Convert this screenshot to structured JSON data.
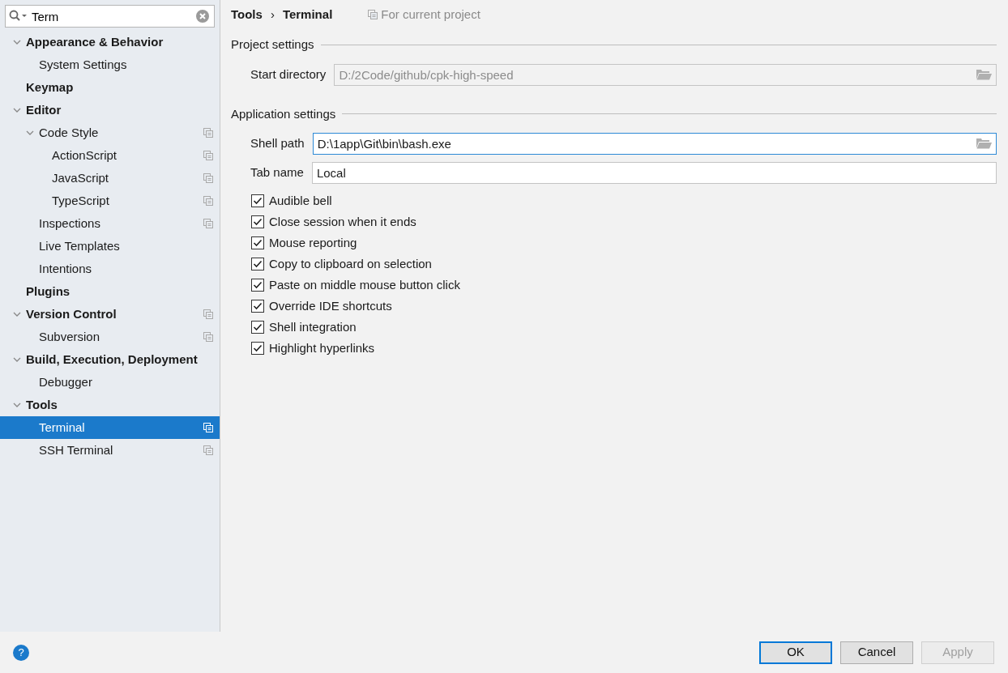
{
  "search": {
    "value": "Term"
  },
  "tree": [
    {
      "label": "Appearance & Behavior",
      "expanded": true,
      "project_scope": false,
      "selected": false,
      "children": [
        {
          "label": "System Settings",
          "project_scope": false,
          "selected": false
        }
      ]
    },
    {
      "label": "Keymap",
      "project_scope": false,
      "selected": false
    },
    {
      "label": "Editor",
      "expanded": true,
      "project_scope": false,
      "selected": false,
      "children": [
        {
          "label": "Code Style",
          "expanded": true,
          "project_scope": true,
          "selected": false,
          "children": [
            {
              "label": "ActionScript",
              "project_scope": true,
              "selected": false
            },
            {
              "label": "JavaScript",
              "project_scope": true,
              "selected": false
            },
            {
              "label": "TypeScript",
              "project_scope": true,
              "selected": false
            }
          ]
        },
        {
          "label": "Inspections",
          "project_scope": true,
          "selected": false
        },
        {
          "label": "Live Templates",
          "project_scope": false,
          "selected": false
        },
        {
          "label": "Intentions",
          "project_scope": false,
          "selected": false
        }
      ]
    },
    {
      "label": "Plugins",
      "project_scope": false,
      "selected": false
    },
    {
      "label": "Version Control",
      "expanded": true,
      "project_scope": true,
      "selected": false,
      "children": [
        {
          "label": "Subversion",
          "project_scope": true,
          "selected": false
        }
      ]
    },
    {
      "label": "Build, Execution, Deployment",
      "expanded": true,
      "project_scope": false,
      "selected": false,
      "children": [
        {
          "label": "Debugger",
          "project_scope": false,
          "selected": false
        }
      ]
    },
    {
      "label": "Tools",
      "expanded": true,
      "project_scope": false,
      "selected": false,
      "children": [
        {
          "label": "Terminal",
          "project_scope": true,
          "selected": true
        },
        {
          "label": "SSH Terminal",
          "project_scope": true,
          "selected": false
        }
      ]
    }
  ],
  "breadcrumb": [
    "Tools",
    "Terminal"
  ],
  "breadcrumb_separator": "›",
  "scope_note": "For current project",
  "sections": [
    {
      "title": "Project settings",
      "fields": [
        {
          "label": "Start directory",
          "value": "D:/2Code/github/cpk-high-speed",
          "disabled": true,
          "focused": false,
          "browse": true
        }
      ]
    },
    {
      "title": "Application settings",
      "fields": [
        {
          "label": "Shell path",
          "value": "D:\\1app\\Git\\bin\\bash.exe",
          "disabled": false,
          "focused": true,
          "browse": true
        },
        {
          "label": "Tab name",
          "value": "Local",
          "disabled": false,
          "focused": false,
          "browse": false
        }
      ]
    }
  ],
  "options": [
    {
      "label": "Audible bell",
      "checked": true
    },
    {
      "label": "Close session when it ends",
      "checked": true
    },
    {
      "label": "Mouse reporting",
      "checked": true
    },
    {
      "label": "Copy to clipboard on selection",
      "checked": true
    },
    {
      "label": "Paste on middle mouse button click",
      "checked": true
    },
    {
      "label": "Override IDE shortcuts",
      "checked": true
    },
    {
      "label": "Shell integration",
      "checked": true
    },
    {
      "label": "Highlight hyperlinks",
      "checked": true
    }
  ],
  "help": "?",
  "buttons": [
    {
      "label": "OK",
      "default": true,
      "disabled": false
    },
    {
      "label": "Cancel",
      "default": false,
      "disabled": false
    },
    {
      "label": "Apply",
      "default": false,
      "disabled": true
    }
  ]
}
